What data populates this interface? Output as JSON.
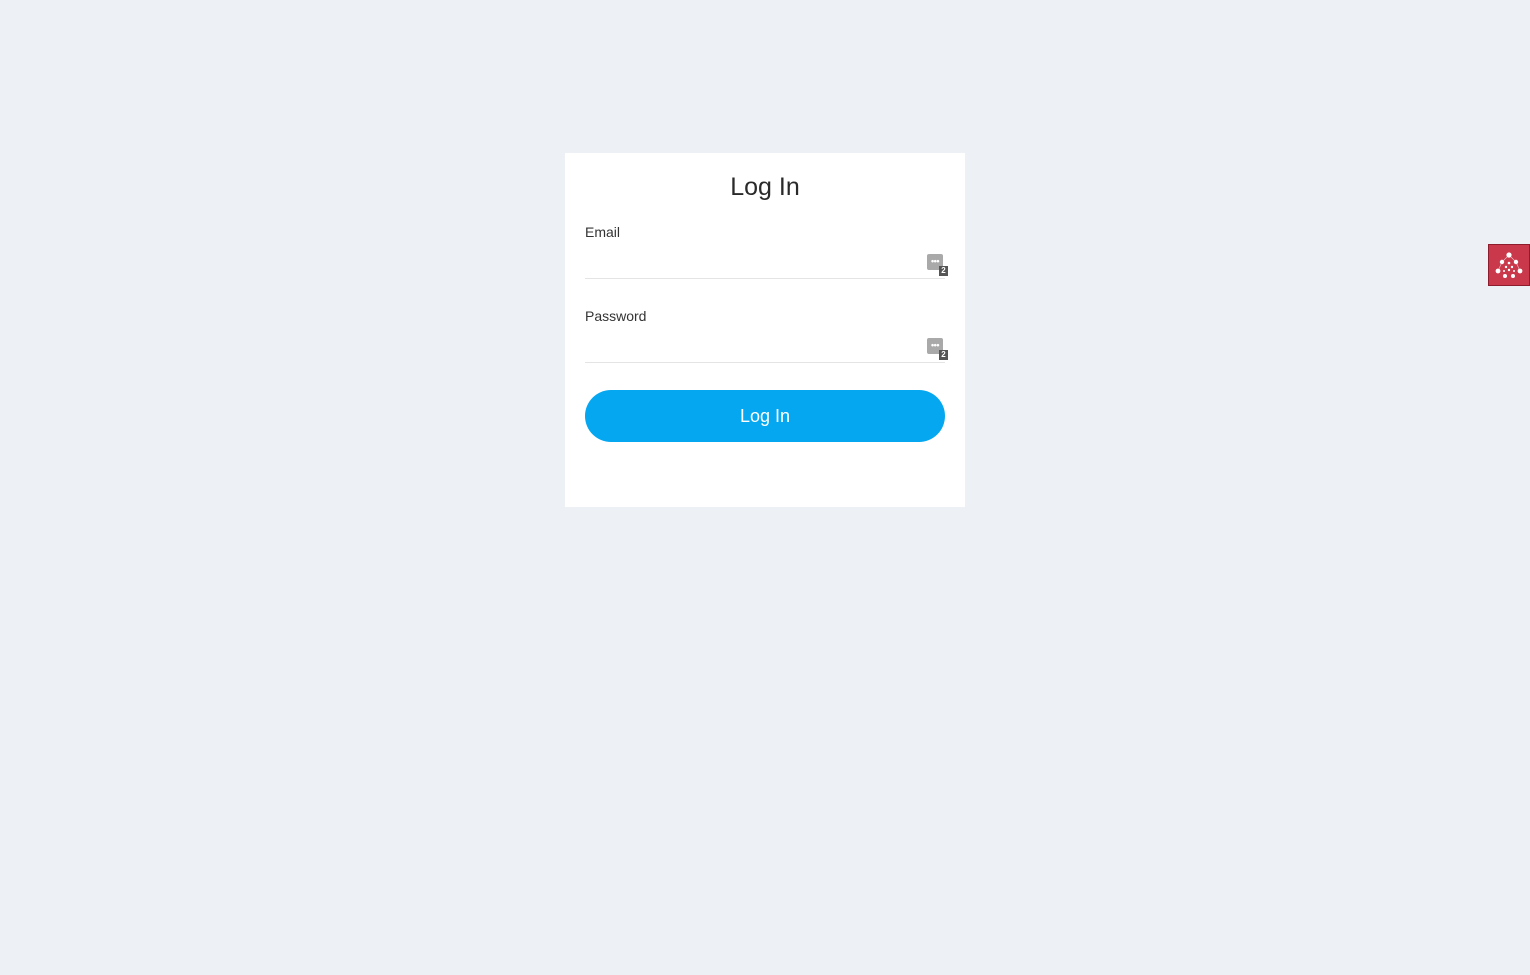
{
  "login_card": {
    "title": "Log In",
    "email_label": "Email",
    "email_value": "",
    "password_label": "Password",
    "password_value": "",
    "submit_label": "Log In",
    "accent_color": "#05a7f0"
  },
  "password_manager": {
    "icon": "password-manager-icon",
    "saved_count": "2"
  },
  "extension": {
    "icon": "network-dots-icon",
    "color": "#c9384b"
  }
}
